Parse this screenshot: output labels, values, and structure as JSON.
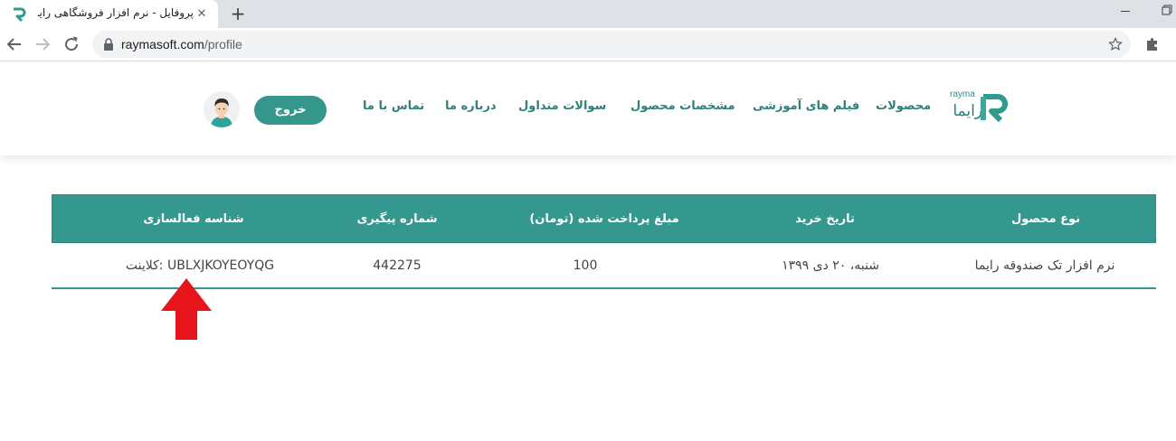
{
  "browser": {
    "tab_title": "پروفایل - نرم افزار فروشگاهی رایما",
    "tab_close": "✕",
    "new_tab": "+",
    "url_domain": "raymasoft.com",
    "url_path": "/profile"
  },
  "site": {
    "logo_latin": "rayma",
    "logo_farsi": "رایما",
    "nav": {
      "products": "محصولات",
      "tutorials": "فیلم های آموزشی",
      "specs": "مشخصات محصول",
      "faq": "سوالات متداول",
      "about": "درباره ما",
      "contact": "تماس با ما"
    },
    "logout_label": "خروج"
  },
  "table": {
    "headers": {
      "product_type": "نوع محصول",
      "purchase_date": "تاریخ خرید",
      "amount_paid": "مبلغ پرداخت شده (تومان)",
      "tracking_number": "شماره پیگیری",
      "activation_id": "شناسه فعالسازی"
    },
    "rows": [
      {
        "product_type": "نرم افزار تک صندوقه رایما",
        "purchase_date": "شنبه، ۲۰ دی ۱۳۹۹",
        "amount_paid": "100",
        "tracking_number": "442275",
        "activation_id": "کلاینت: UBLXJKOYEOYQG"
      }
    ]
  },
  "colors": {
    "brand": "#35988e",
    "brand_dark": "#2d8178",
    "annotation_arrow": "#e8141c"
  }
}
